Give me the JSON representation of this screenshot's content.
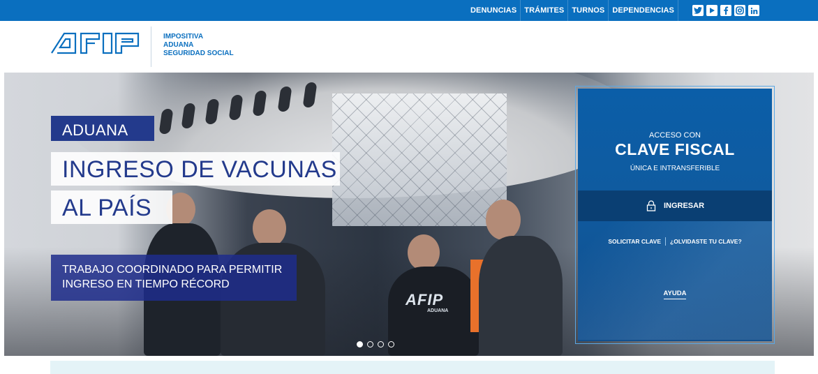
{
  "topnav": {
    "items": [
      {
        "label": "DENUNCIAS"
      },
      {
        "label": "TRÁMITES"
      },
      {
        "label": "TURNOS"
      },
      {
        "label": "DEPENDENCIAS"
      }
    ],
    "social": [
      "twitter-icon",
      "youtube-icon",
      "facebook-icon",
      "instagram-icon",
      "linkedin-icon"
    ]
  },
  "header": {
    "logo_text": "AFIP",
    "lines": [
      "IMPOSITIVA",
      "ADUANA",
      "SEGURIDAD SOCIAL"
    ]
  },
  "hero": {
    "tag": "ADUANA",
    "headline_1": "INGRESO DE VACUNAS",
    "headline_2": "AL PAÍS",
    "subtext_1": "TRABAJO COORDINADO PARA PERMITIR",
    "subtext_2": "INGRESO EN TIEMPO RÉCORD",
    "vest_logo": "AFIP",
    "vest_sub": "ADUANA",
    "slides": 4,
    "active_slide": 1
  },
  "login_panel": {
    "acceso": "ACCESO CON",
    "clave": "CLAVE FISCAL",
    "unica": "ÚNICA E INTRANSFERIBLE",
    "ingresar": "INGRESAR",
    "solicitar": "SOLICITAR CLAVE",
    "olvidaste": "¿OLVIDASTE TU CLAVE?",
    "ayuda": "AYUDA"
  },
  "colors": {
    "brand_blue": "#0a6fbf",
    "navy": "#233a8c",
    "panel_blue": "#0b5ea8",
    "panel_dark": "#0a3f73"
  }
}
